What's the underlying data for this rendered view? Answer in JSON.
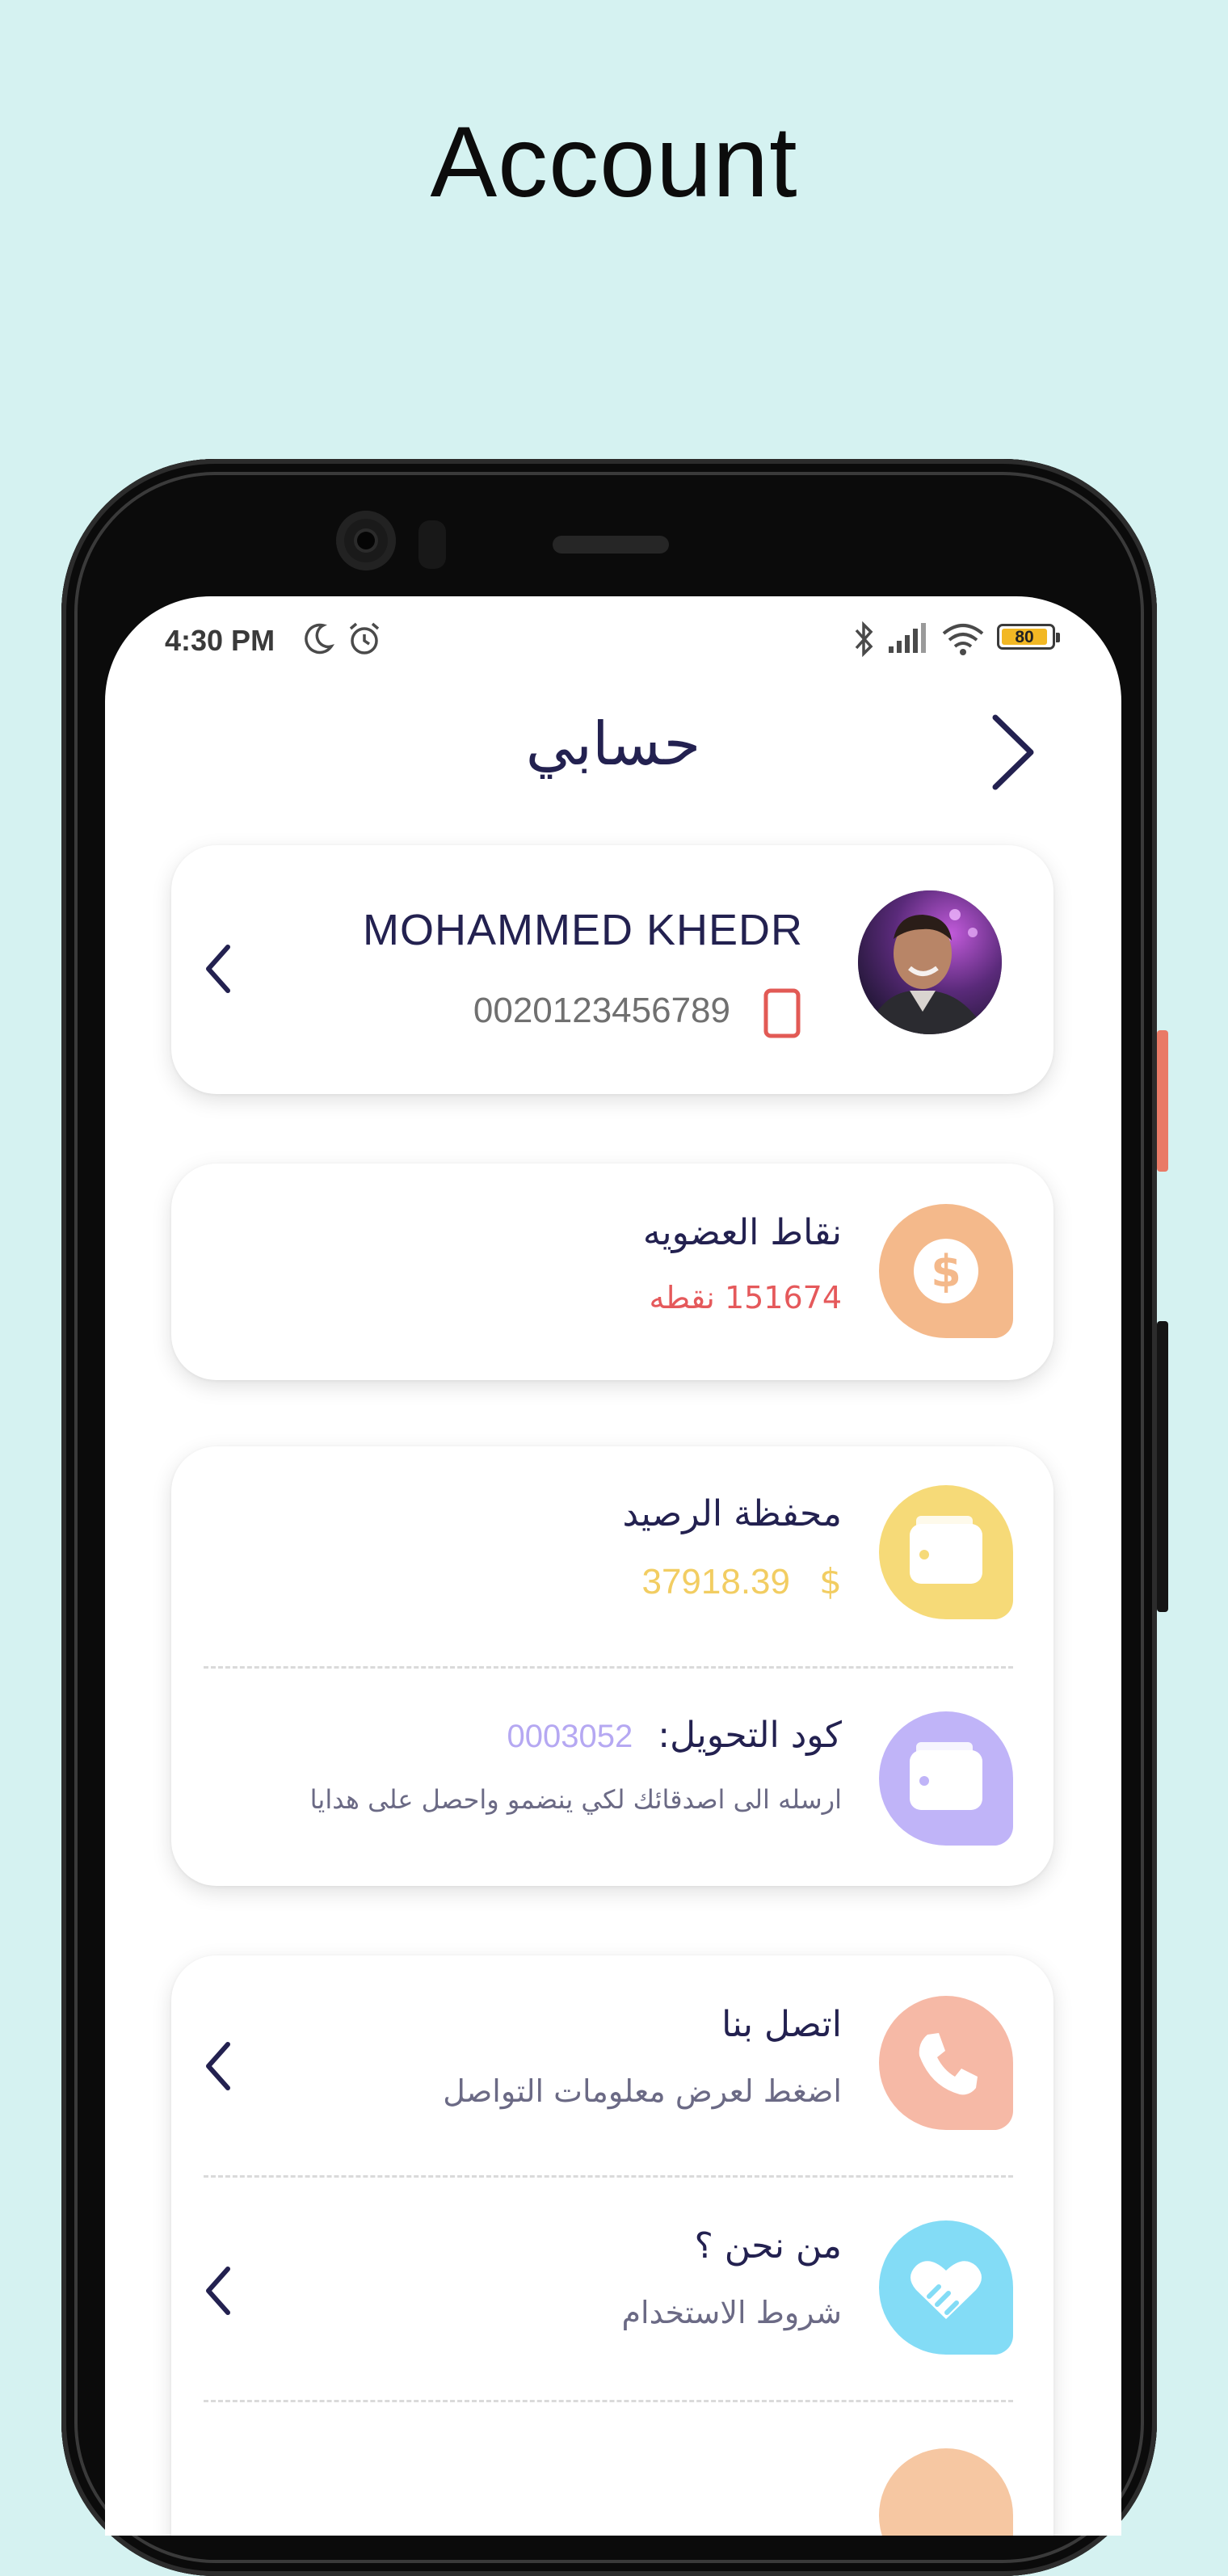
{
  "headline": "Account",
  "status_bar": {
    "time": "4:30 PM",
    "battery": "80",
    "icons": [
      "moon-icon",
      "alarm-icon",
      "bluetooth-icon",
      "signal-icon",
      "wifi-icon",
      "battery-icon"
    ]
  },
  "header": {
    "title": "حسابي",
    "back_icon": "chevron-right-icon"
  },
  "profile": {
    "name": "MOHAMMED KHEDR",
    "phone": "0020123456789",
    "avatar": "user-avatar",
    "phone_icon": "mobile-phone-icon",
    "chevron": "chevron-left-icon"
  },
  "points": {
    "title": "نقاط العضويه",
    "value": "151674 نقطه",
    "icon": "dollar-coin-icon",
    "icon_bg": "#f4b98b",
    "value_color": "#e5595b"
  },
  "wallet": {
    "title": "محفظة الرصيد",
    "amount": "37918.39",
    "currency": "$",
    "icon": "wallet-icon",
    "icon_bg": "#f6da78",
    "value_color": "#f2cd62"
  },
  "referral": {
    "label": "كود التحويل:",
    "code": "0003052",
    "hint": "ارسله الى اصدقائك لكي ينضمو واحصل على هدايا",
    "icon": "wallet-icon",
    "icon_bg": "#c0b4f8",
    "code_color": "#b5a8f2"
  },
  "contact": {
    "title": "اتصل بنا",
    "subtitle": "اضغط لعرض معلومات التواصل",
    "icon": "phone-call-icon",
    "icon_bg": "#f6b9a6"
  },
  "about": {
    "title": "من نحن ؟",
    "subtitle": "شروط الاستخدام",
    "icon": "handshake-heart-icon",
    "icon_bg": "#83dcf6"
  },
  "colors": {
    "background": "#d5f2f1",
    "primary_text": "#232150",
    "secondary_text": "#6b6a85"
  }
}
